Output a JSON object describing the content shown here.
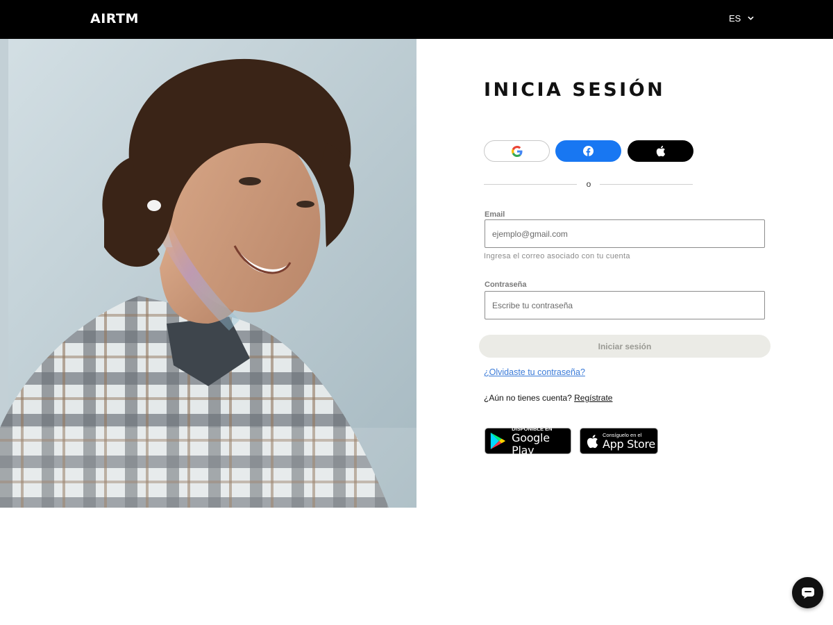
{
  "header": {
    "logo_text": "AIRTM",
    "language": "ES",
    "background": "#000000"
  },
  "hero_image": {
    "description_icon": "smiling-young-man-photo"
  },
  "login": {
    "title": "INICIA SESIÓN",
    "social": {
      "google_icon": "google-icon",
      "facebook_icon": "facebook-icon",
      "facebook_color": "#1877f2",
      "apple_icon": "apple-icon"
    },
    "divider_text": "o",
    "email": {
      "label": "Email",
      "placeholder": "ejemplo@gmail.com",
      "value": "",
      "hint": "Ingresa el correo asociado con tu cuenta"
    },
    "password": {
      "label": "Contraseña",
      "placeholder": "Escribe tu contraseña",
      "value": ""
    },
    "submit_label": "Iniciar sesión",
    "forgot_label": "¿Olvidaste tu contraseña?",
    "signup_prompt": "¿Aún no tienes cuenta?",
    "signup_link": "Regístrate",
    "google_play": {
      "small": "DISPONIBLE EN",
      "big": "Google Play"
    },
    "app_store": {
      "small": "Consíguelo en el",
      "big": "App Store"
    }
  },
  "chat": {
    "icon": "chat-bubble-icon"
  },
  "colors": {
    "link": "#3b7bd8",
    "submit_bg": "#ebebe6",
    "submit_text": "#9a9a94"
  }
}
